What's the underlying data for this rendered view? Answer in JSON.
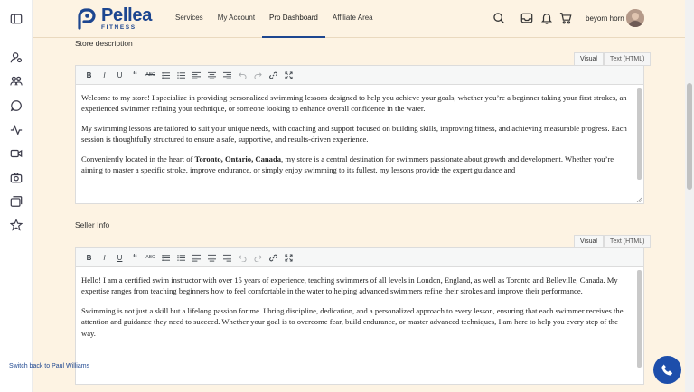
{
  "header": {
    "logo_name": "Pellea",
    "logo_sub": "FITNESS",
    "nav": [
      {
        "label": "Services"
      },
      {
        "label": "My Account"
      },
      {
        "label": "Pro Dashboard"
      },
      {
        "label": "Affiliate Area"
      }
    ],
    "username": "beyorn horn"
  },
  "icons": {
    "rail": [
      "sidebar-toggle-icon",
      "users-icon",
      "group-icon",
      "chat-icon",
      "activity-icon",
      "video-icon",
      "camera-icon",
      "cards-icon",
      "star-icon"
    ],
    "header": [
      "search-icon",
      "inbox-icon",
      "bell-icon",
      "cart-icon"
    ]
  },
  "store_description": {
    "title": "Store description",
    "tab_visual": "Visual",
    "tab_text": "Text (HTML)",
    "p1": "Welcome to my store! I specialize in providing personalized swimming lessons designed to help you achieve your goals, whether you’re a beginner taking your first strokes, an experienced swimmer refining your technique, or someone looking to enhance overall confidence in the water.",
    "p2": "My swimming lessons are tailored to suit your unique needs, with coaching and support focused on building skills, improving fitness, and achieving measurable progress. Each session is thoughtfully structured to ensure a safe, supportive, and results-driven experience.",
    "p3_before": "Conveniently located in the heart of ",
    "p3_bold": "Toronto, Ontario, Canada",
    "p3_after": ", my store is a central destination for swimmers passionate about growth and development. Whether you’re aiming to master a specific stroke, improve endurance, or simply enjoy swimming to its fullest, my lessons provide the expert guidance and"
  },
  "seller_info": {
    "title": "Seller Info",
    "tab_visual": "Visual",
    "tab_text": "Text (HTML)",
    "p1": "Hello! I am a certified swim instructor with over 15 years of experience, teaching swimmers of all levels in London, England, as well as Toronto and Belleville, Canada. My expertise ranges from teaching beginners how to feel comfortable in the water to helping advanced swimmers refine their strokes and improve their performance.",
    "p2": "Swimming is not just a skill but a lifelong passion for me. I bring discipline, dedication, and a personalized approach to every lesson, ensuring that each swimmer receives the attention and guidance they need to succeed. Whether your goal is to overcome fear, build endurance, or master advanced techniques, I am here to help you every step of the way."
  },
  "footer": {
    "switch_back": "Switch back to Paul Williams"
  },
  "colors": {
    "brand": "#1d4690",
    "background": "#fdf3e3",
    "call_button": "#1d4eab"
  }
}
